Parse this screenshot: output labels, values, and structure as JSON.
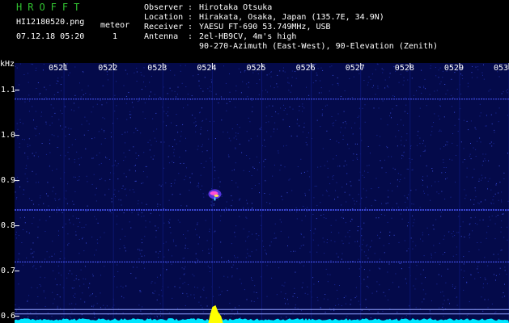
{
  "app": {
    "title": "HROFFT"
  },
  "capture": {
    "file": "HI12180520.png",
    "timestamp": "07.12.18 05:20",
    "meteor_label": "meteor",
    "meteor_count": "1"
  },
  "station": [
    {
      "key": "Observer",
      "value": "Hirotaka Otsuka"
    },
    {
      "key": "Location",
      "value": "Hirakata, Osaka, Japan (135.7E, 34.9N)"
    },
    {
      "key": "Receiver",
      "value": "YAESU FT-690 53.749MHz, USB"
    },
    {
      "key": "Antenna",
      "value": "2el-HB9CV, 4m's high"
    },
    {
      "key": "",
      "value": "90-270-Azimuth (East-West), 90-Elevation (Zenith)"
    }
  ],
  "colors": {
    "background": "#000000",
    "plot_background": "#040a4a",
    "title": "#31c231",
    "noise_floor": "#00e6ff",
    "signal_peak": "#ffff00",
    "interference_line": "#4d5aff"
  },
  "chart_data": {
    "type": "heatmap",
    "ylabel": "kHz",
    "x_ticks": [
      "0521",
      "0522",
      "0523",
      "0524",
      "0525",
      "0526",
      "0527",
      "0528",
      "0529",
      "0530"
    ],
    "y_ticks": [
      "1.1",
      "1.0",
      "0.9",
      "0.8",
      "0.7",
      "0.6"
    ],
    "ylim": [
      0.585,
      1.16
    ],
    "x_unit": "minutes after 05:20",
    "xlim": [
      0,
      10
    ],
    "meteor_echoes": [
      {
        "time_min": 4.05,
        "freq_khz": 0.87
      }
    ],
    "interference_lines_khz": [
      0.835,
      0.72,
      1.08,
      0.615,
      0.605
    ]
  }
}
